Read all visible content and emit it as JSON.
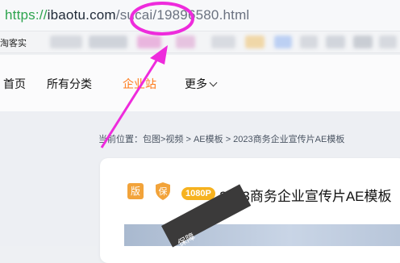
{
  "url": {
    "scheme": "https://",
    "host": "ibaotu.com",
    "path": "/sucai/19896580.html"
  },
  "bookmarks": {
    "first_label": "淘客实"
  },
  "nav": {
    "items": [
      {
        "label": "首页"
      },
      {
        "label": "所有分类"
      },
      {
        "label": "企业站"
      },
      {
        "label": "更多"
      }
    ],
    "accent_color": "#ff7a1a"
  },
  "breadcrumb": {
    "text": "当前位置：包图>视频 > AE模板 > 2023商务企业宣传片AE模板"
  },
  "product": {
    "badge_ban": "版",
    "badge_bao": "保",
    "resolution": "1080P",
    "title": "2023商务企业宣传片AE模板"
  },
  "preview": {
    "ribbon_text": "保障"
  },
  "colors": {
    "highlight": "#ee2bdc",
    "badge": "#f6b21f"
  }
}
